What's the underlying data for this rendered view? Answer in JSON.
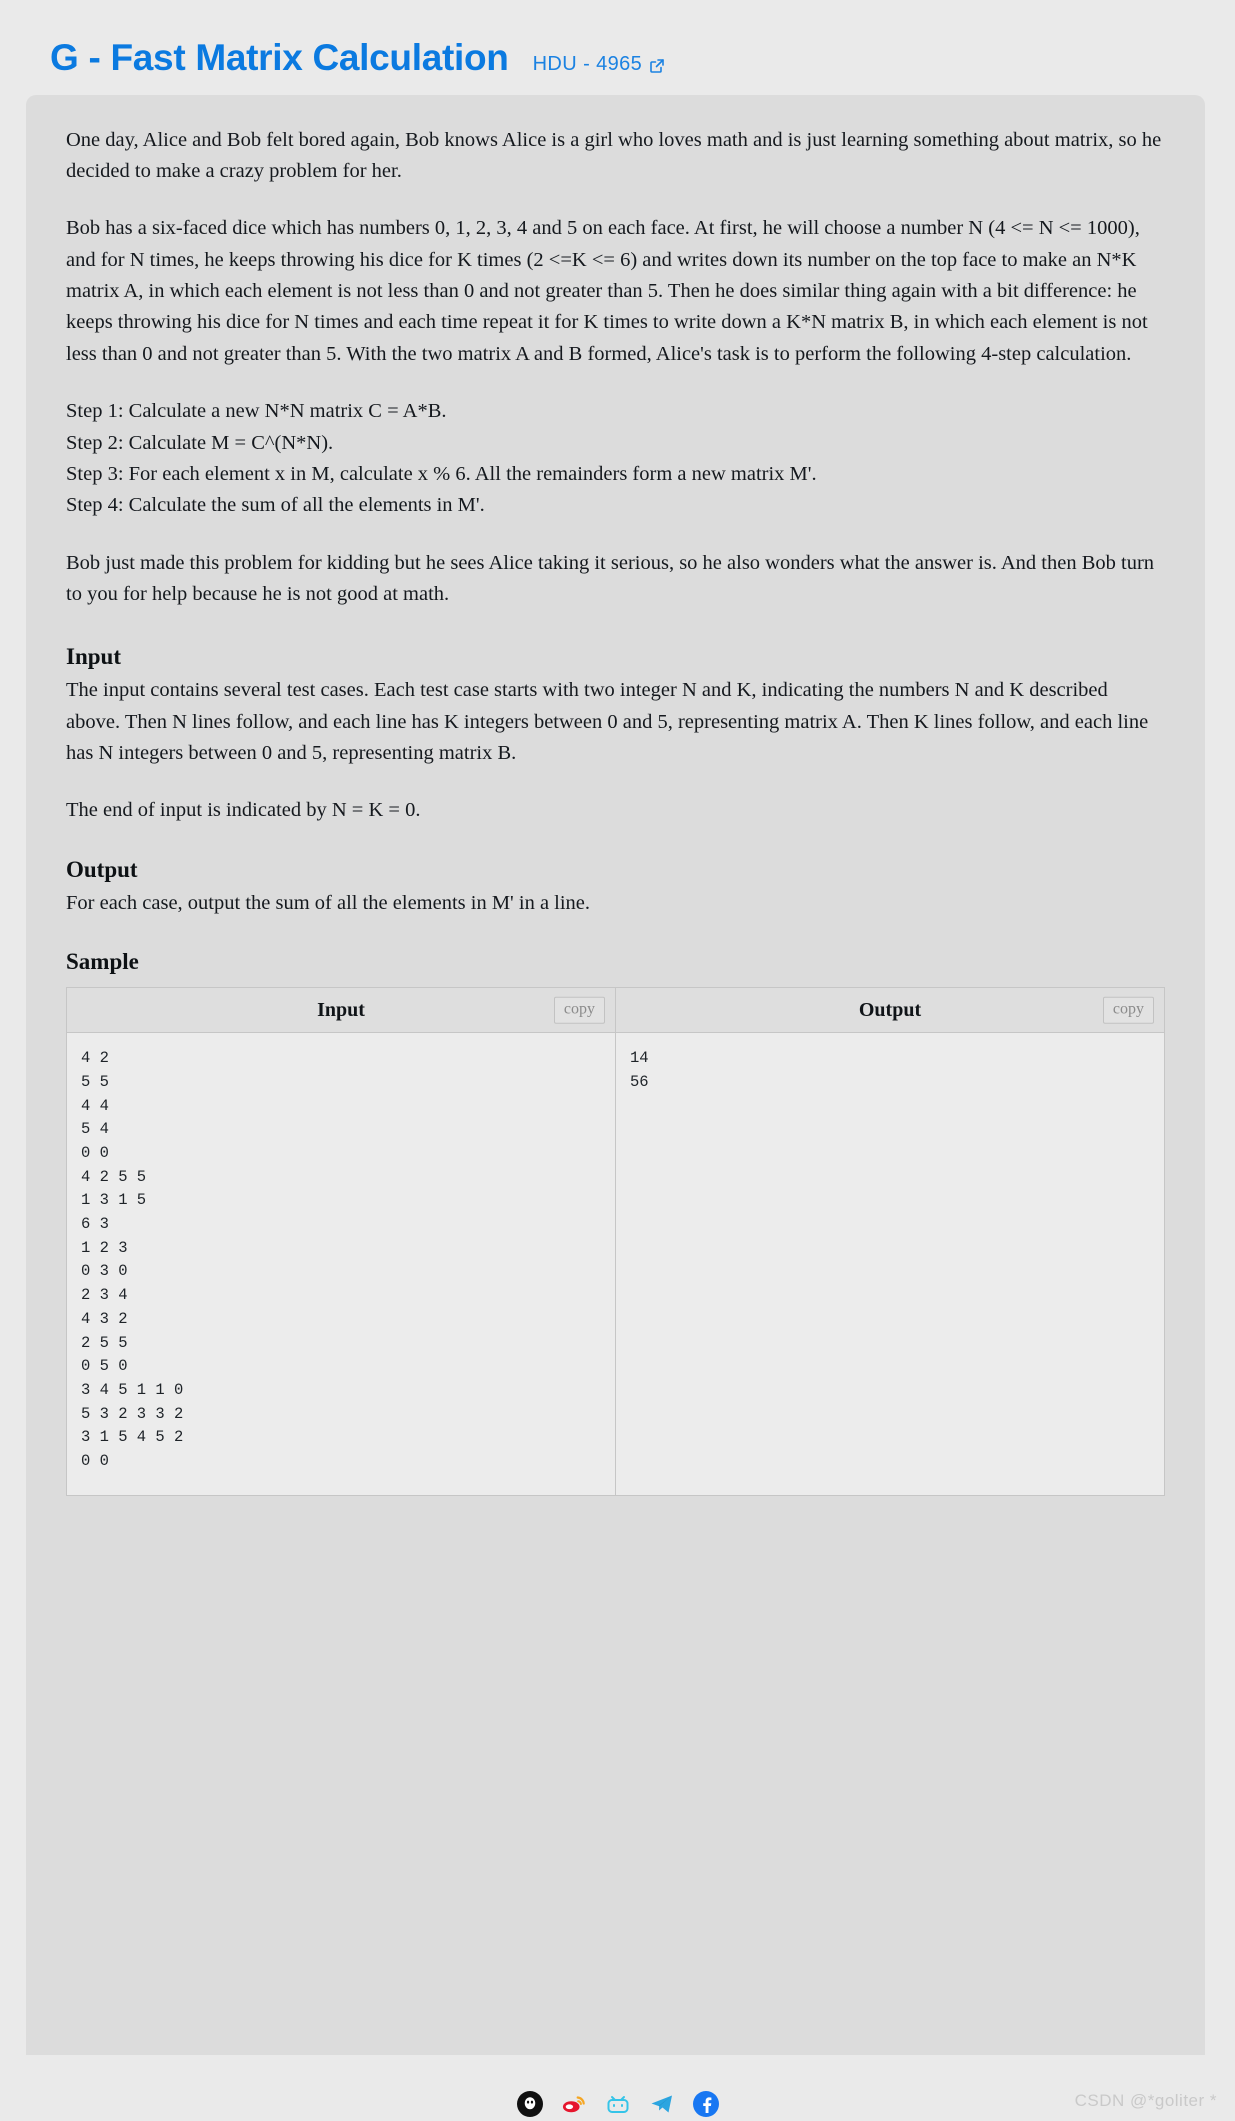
{
  "header": {
    "problem_title": "G - Fast Matrix Calculation",
    "source_label": "HDU - 4965",
    "external_link_icon": "external-link-icon"
  },
  "statement": {
    "paragraphs": [
      "One day, Alice and Bob felt bored again, Bob knows Alice is a girl who loves math and is just learning something about matrix, so he decided to make a crazy problem for her.",
      "Bob has a six-faced dice which has numbers 0, 1, 2, 3, 4 and 5 on each face. At first, he will choose a number N (4 <= N <= 1000), and for N times, he keeps throwing his dice for K times (2 <=K <= 6) and writes down its number on the top face to make an N*K matrix A, in which each element is not less than 0 and not greater than 5. Then he does similar thing again with a bit difference: he keeps throwing his dice for N times and each time repeat it for K times to write down a K*N matrix B, in which each element is not less than 0 and not greater than 5. With the two matrix A and B formed, Alice's task is to perform the following 4-step calculation."
    ],
    "steps": [
      "Step 1: Calculate a new N*N matrix C = A*B.",
      "Step 2: Calculate M = C^(N*N).",
      "Step 3: For each element x in M, calculate x % 6. All the remainders form a new matrix M'.",
      "Step 4: Calculate the sum of all the elements in M'."
    ],
    "closing": "Bob just made this problem for kidding but he sees Alice taking it serious, so he also wonders what the answer is. And then Bob turn to you for help because he is not good at math."
  },
  "sections": {
    "input": {
      "heading": "Input",
      "paragraphs": [
        "The input contains several test cases. Each test case starts with two integer N and K, indicating the numbers N and K described above. Then N lines follow, and each line has K integers between 0 and 5, representing matrix A. Then K lines follow, and each line has N integers between 0 and 5, representing matrix B.",
        "The end of input is indicated by N = K = 0."
      ]
    },
    "output": {
      "heading": "Output",
      "paragraphs": [
        "For each case, output the sum of all the elements in M' in a line."
      ]
    },
    "sample": {
      "heading": "Sample",
      "input_header": "Input",
      "output_header": "Output",
      "copy_label": "copy",
      "input_text": "4 2\n5 5\n4 4\n5 4\n0 0\n4 2 5 5\n1 3 1 5\n6 3\n1 2 3\n0 3 0\n2 3 4\n4 3 2\n2 5 5\n0 5 0\n3 4 5 1 1 0\n5 3 2 3 3 2\n3 1 5 4 5 2\n0 0",
      "output_text": "14\n56"
    }
  },
  "share": {
    "icons": [
      {
        "name": "qq-share-icon",
        "color": "#111111"
      },
      {
        "name": "weibo-share-icon",
        "color": "#e6162d"
      },
      {
        "name": "bilibili-share-icon",
        "color": "#35c4e8"
      },
      {
        "name": "telegram-share-icon",
        "color": "#2ca5e0"
      },
      {
        "name": "facebook-share-icon",
        "color": "#1877f2"
      }
    ]
  },
  "watermark": {
    "text": "CSDN @*goliter *"
  },
  "colors": {
    "page_background": "#eaeaea",
    "panel_background": "#dcdcdc",
    "title_blue": "#0b7ae0",
    "link_blue": "#1b82e2",
    "table_border": "#c6c6c6",
    "table_header_bg": "#dedede",
    "code_bg": "#ececec"
  }
}
